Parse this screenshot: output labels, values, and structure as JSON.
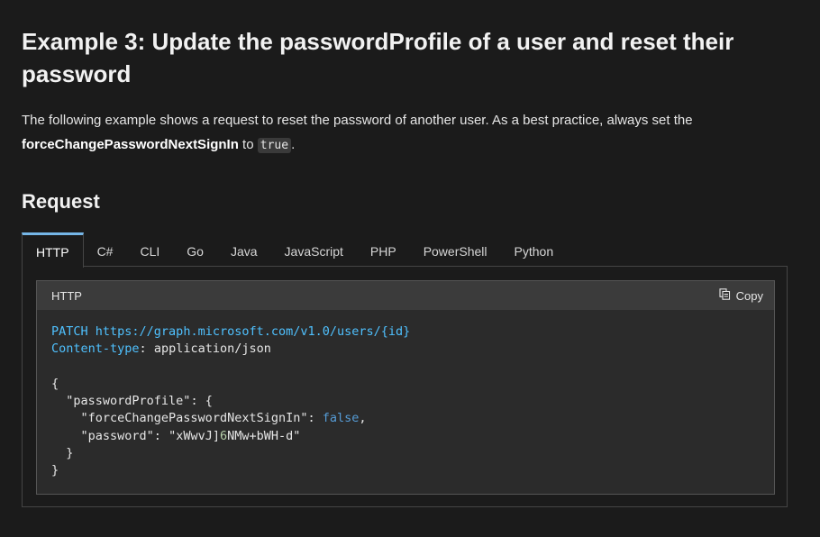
{
  "heading": {
    "title": "Example 3: Update the passwordProfile of a user and reset their password"
  },
  "description": {
    "text_before": "The following example shows a request to reset the password of another user. As a best practice, always set the ",
    "bold_term": "forceChangePasswordNextSignIn",
    "text_middle": " to ",
    "inline_code": "true",
    "text_after": "."
  },
  "request_heading": "Request",
  "tabs": [
    {
      "label": "HTTP",
      "active": true
    },
    {
      "label": "C#",
      "active": false
    },
    {
      "label": "CLI",
      "active": false
    },
    {
      "label": "Go",
      "active": false
    },
    {
      "label": "Java",
      "active": false
    },
    {
      "label": "JavaScript",
      "active": false
    },
    {
      "label": "PHP",
      "active": false
    },
    {
      "label": "PowerShell",
      "active": false
    },
    {
      "label": "Python",
      "active": false
    }
  ],
  "code_block": {
    "language_label": "HTTP",
    "copy_label": "Copy",
    "copy_icon": "copy-icon",
    "method": "PATCH",
    "url": "https://graph.microsoft.com/v1.0/users/{id}",
    "header_name": "Content-type",
    "header_value": "application/json",
    "open_brace": "{",
    "profile_key": "\"passwordProfile\"",
    "force_key": "\"forceChangePasswordNextSignIn\"",
    "force_value": "false",
    "password_key": "\"password\"",
    "password_value_part1": "\"xWwvJ]",
    "password_value_digit": "6",
    "password_value_part2": "NMw+bWH-d\"",
    "inner_close": "}",
    "close_brace": "}"
  },
  "colors": {
    "background": "#1b1b1b",
    "active_tab_accent": "#75b6e7",
    "code_keyword": "#4fc1ff",
    "code_boolean": "#569cd6",
    "code_number": "#b5cea8"
  }
}
